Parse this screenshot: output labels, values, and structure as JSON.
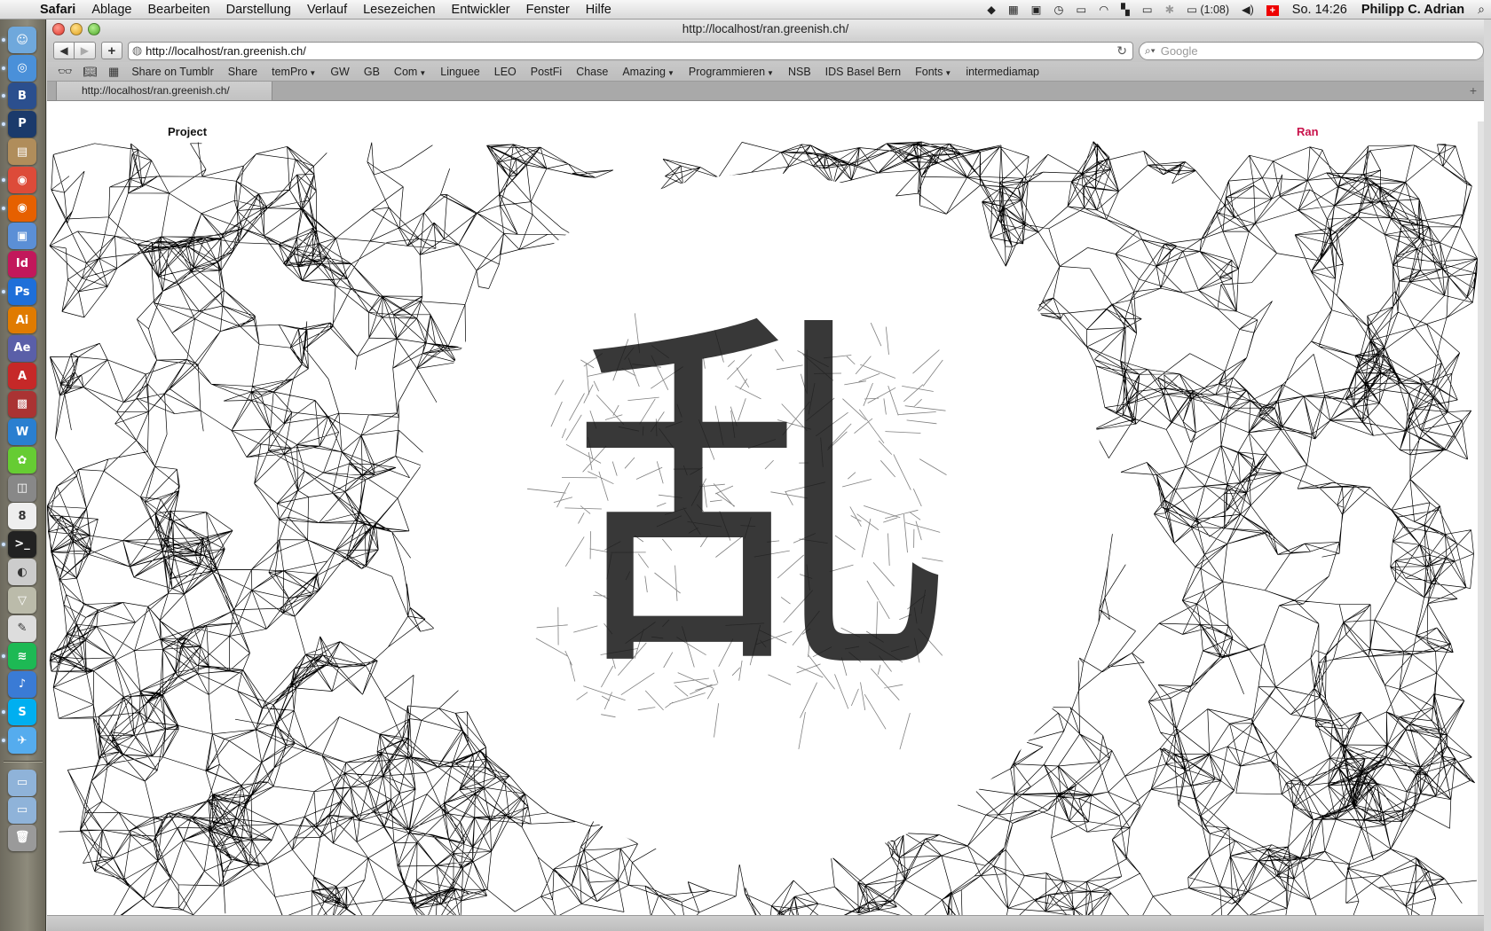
{
  "menubar": {
    "app": "Safari",
    "items": [
      "Ablage",
      "Bearbeiten",
      "Darstellung",
      "Verlauf",
      "Lesezeichen",
      "Entwickler",
      "Fenster",
      "Hilfe"
    ],
    "battery": "(1:08)",
    "clock": "So. 14:26",
    "user": "Philipp C. Adrian"
  },
  "window": {
    "title": "http://localhost/ran.greenish.ch/",
    "url": "http://localhost/ran.greenish.ch/",
    "search_placeholder": "Google",
    "tab_title": "http://localhost/ran.greenish.ch/",
    "bookmarks": [
      "Share on Tumblr",
      "Share",
      "temPro",
      "GW",
      "GB",
      "Com",
      "Linguee",
      "LEO",
      "PostFi",
      "Chase",
      "Amazing",
      "Programmieren",
      "NSB",
      "IDS Basel Bern",
      "Fonts",
      "intermediamap"
    ],
    "bookmark_menus": [
      "temPro",
      "Com",
      "Amazing",
      "Programmieren",
      "Fonts"
    ]
  },
  "page": {
    "nav_left": "Project",
    "nav_right": "Ran",
    "accent_color": "#c8114a",
    "artwork_glyph": "乱"
  },
  "dock": {
    "icons": [
      "finder-icon",
      "safari-icon",
      "bbedit-icon",
      "pagico-icon",
      "stack-icon",
      "chrome-icon",
      "firefox-icon",
      "preview-icon",
      "indesign-icon",
      "photoshop-icon",
      "illustrator-icon",
      "aftereffects-icon",
      "acrobat-icon",
      "toolbox-icon",
      "wunderlist-icon",
      "growl-icon",
      "photo-icon",
      "calendar-icon",
      "terminal-icon",
      "disk-icon",
      "ftp-icon",
      "textedit-icon",
      "spotify-icon",
      "itunes-icon",
      "skype-icon",
      "twitter-icon"
    ],
    "calendar_day": "8"
  }
}
